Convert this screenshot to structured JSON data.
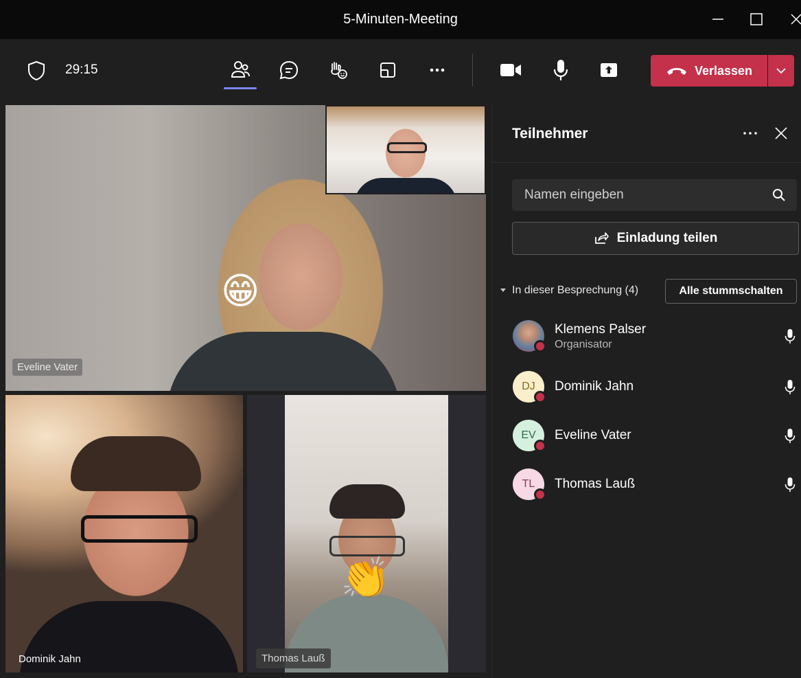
{
  "window": {
    "title": "5-Minuten-Meeting"
  },
  "toolbar": {
    "timer": "29:15",
    "leave_label": "Verlassen"
  },
  "videos": {
    "eveline": {
      "name": "Eveline Vater",
      "reaction": "😁"
    },
    "klemens": {
      "name": "Klemens Palser"
    },
    "dominik": {
      "name": "Dominik Jahn"
    },
    "thomas": {
      "name": "Thomas Lauß",
      "reaction": "👏"
    }
  },
  "panel": {
    "title": "Teilnehmer",
    "search_placeholder": "Namen eingeben",
    "invite_label": "Einladung teilen",
    "section_label": "In dieser Besprechung (4)",
    "mute_all_label": "Alle stummschalten",
    "participants": [
      {
        "name": "Klemens Palser",
        "role": "Organisator",
        "initials": "",
        "avatar_bg": "#6b8fb5",
        "avatar_fg": "#ffffff"
      },
      {
        "name": "Dominik Jahn",
        "role": "",
        "initials": "DJ",
        "avatar_bg": "#fbeecb",
        "avatar_fg": "#8a6a1e"
      },
      {
        "name": "Eveline Vater",
        "role": "",
        "initials": "EV",
        "avatar_bg": "#d6f0e0",
        "avatar_fg": "#2e6b46"
      },
      {
        "name": "Thomas Lauß",
        "role": "",
        "initials": "TL",
        "avatar_bg": "#f6d9e4",
        "avatar_fg": "#8c3a5a"
      }
    ]
  },
  "colors": {
    "accent": "#7f85f5",
    "leave": "#c4314b",
    "status_busy": "#c4314b"
  },
  "icons": {
    "shield": "shield-icon",
    "participants": "people-icon",
    "chat": "chat-icon",
    "raise_hand": "raise-hand-icon",
    "view": "view-icon",
    "more": "more-icon",
    "camera": "video-camera-icon",
    "mic": "microphone-icon",
    "share": "share-screen-icon",
    "hangup": "phone-hangup-icon",
    "search": "search-icon",
    "invite": "share-invite-icon"
  }
}
